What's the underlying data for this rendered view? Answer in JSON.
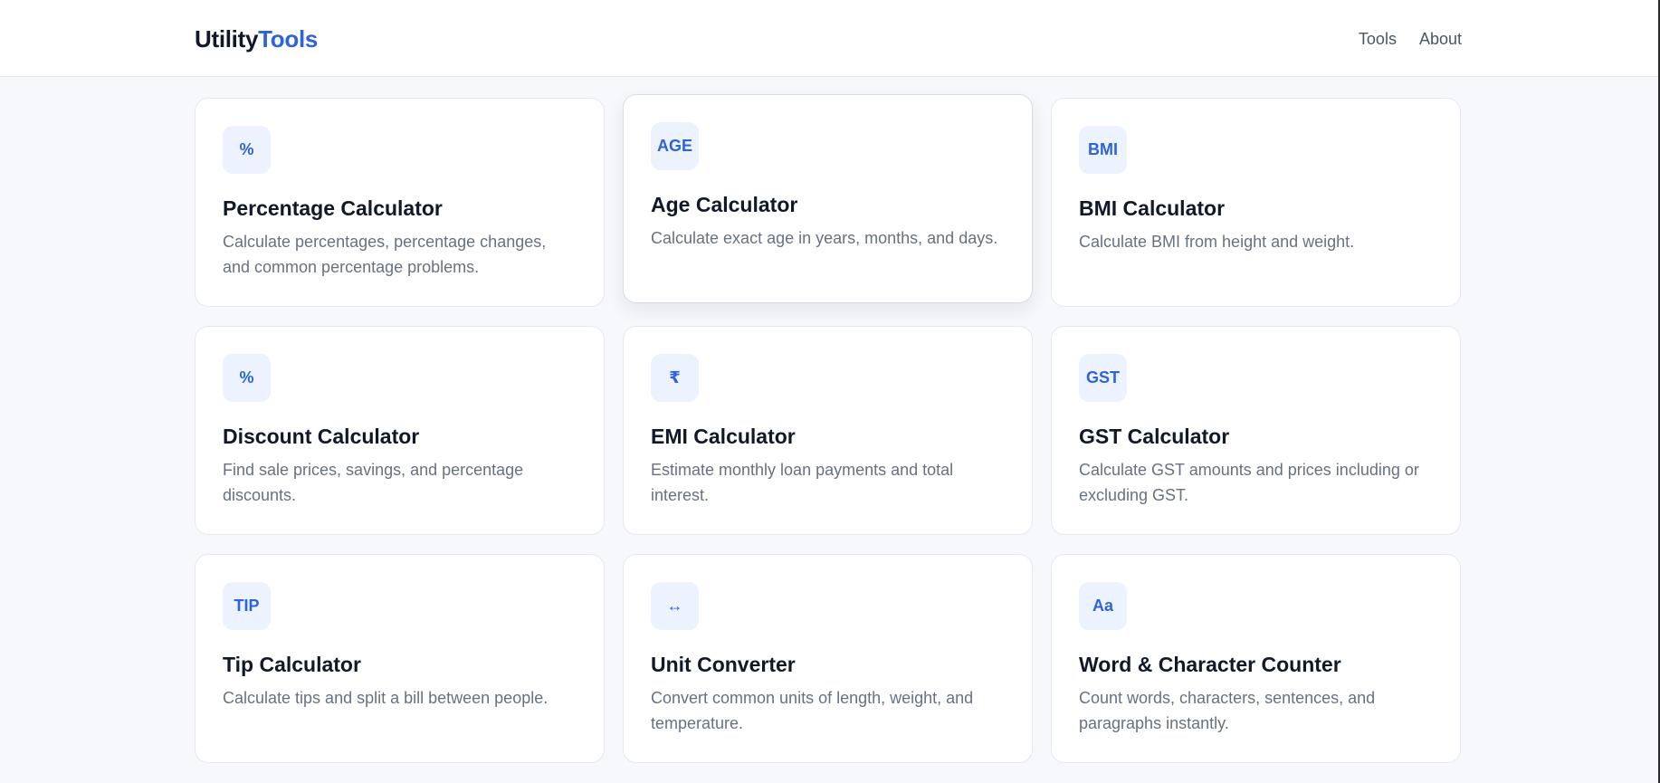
{
  "header": {
    "logo_part1": "Utility",
    "logo_part2": "Tools",
    "nav": [
      "Tools",
      "About"
    ]
  },
  "tools": [
    {
      "icon": "%",
      "icon_name": "percent-icon",
      "title": "Percentage Calculator",
      "desc": "Calculate percentages, percentage changes, and common percentage problems."
    },
    {
      "icon": "AGE",
      "icon_name": "age-icon",
      "title": "Age Calculator",
      "desc": "Calculate exact age in years, months, and days."
    },
    {
      "icon": "BMI",
      "icon_name": "bmi-icon",
      "title": "BMI Calculator",
      "desc": "Calculate BMI from height and weight."
    },
    {
      "icon": "%",
      "icon_name": "percent-icon",
      "title": "Discount Calculator",
      "desc": "Find sale prices, savings, and percentage discounts."
    },
    {
      "icon": "₹",
      "icon_name": "rupee-icon",
      "title": "EMI Calculator",
      "desc": "Estimate monthly loan payments and total interest."
    },
    {
      "icon": "GST",
      "icon_name": "gst-icon",
      "title": "GST Calculator",
      "desc": "Calculate GST amounts and prices including or excluding GST."
    },
    {
      "icon": "TIP",
      "icon_name": "tip-icon",
      "title": "Tip Calculator",
      "desc": "Calculate tips and split a bill between people."
    },
    {
      "icon": "↔",
      "icon_name": "arrows-icon",
      "title": "Unit Converter",
      "desc": "Convert common units of length, weight, and temperature."
    },
    {
      "icon": "Aa",
      "icon_name": "text-icon",
      "title": "Word & Character Counter",
      "desc": "Count words, characters, sentences, and paragraphs instantly."
    }
  ],
  "colors": {
    "accent": "#2f63d8",
    "badge_bg": "#ecf3ff",
    "page_bg": "#f7f8fb"
  }
}
